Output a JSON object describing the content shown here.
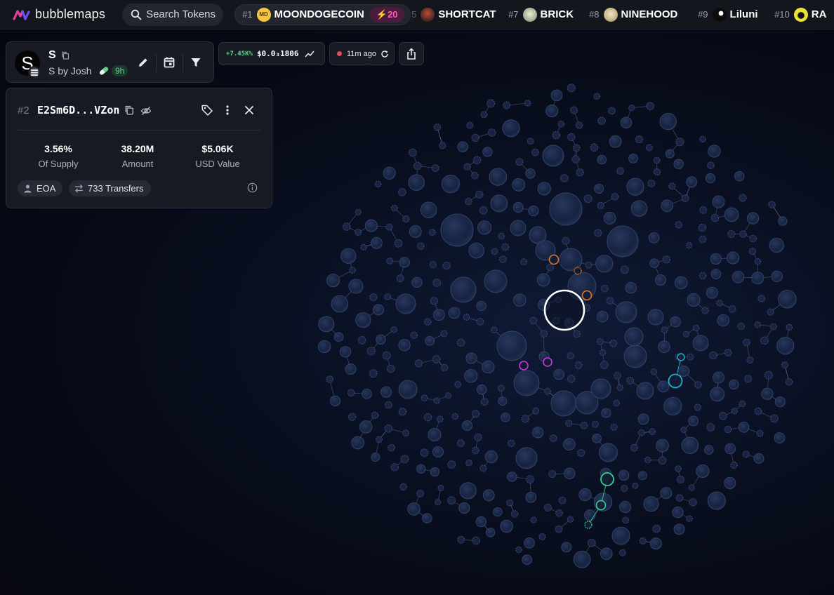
{
  "brand": {
    "name": "bubblemaps"
  },
  "search": {
    "label": "Search Tokens"
  },
  "trending": [
    {
      "rank": "#1",
      "name": "MOONDOGECOIN",
      "boost": "20",
      "avatar_text": "MD",
      "avatar_color": "#f3c745"
    },
    {
      "rank": "5",
      "name": "SHORTCAT",
      "avatar_color": "#5a2f2a"
    },
    {
      "rank": "#7",
      "name": "BRICK",
      "avatar_color": "#b9c2a8"
    },
    {
      "rank": "#8",
      "name": "NINEHOOD",
      "avatar_color": "#c8b48a"
    },
    {
      "rank": "#9",
      "name": "Liluni",
      "avatar_color": "#0c0c0c"
    },
    {
      "rank": "#10",
      "name": "RA",
      "avatar_color": "#e7e13a"
    }
  ],
  "token": {
    "symbol": "S",
    "avatar_letter": "S",
    "name": "S by Josh",
    "age": "9h"
  },
  "price": {
    "change": "+7.45K%",
    "value": "$0.0₃1806"
  },
  "refresh": {
    "label": "11m ago"
  },
  "wallet": {
    "rank": "#2",
    "address": "E2Sm6D...VZon",
    "stats": [
      {
        "value": "3.56%",
        "label": "Of Supply"
      },
      {
        "value": "38.20M",
        "label": "Amount"
      },
      {
        "value": "$5.06K",
        "label": "USD Value"
      }
    ],
    "type": "EOA",
    "transfers": "733 Transfers"
  },
  "colors": {
    "accent_green": "#5fd38f",
    "boost_pink": "#ff5fb4",
    "bubble_fill": "#1c2a4a",
    "highlight_orange": "#e0782a",
    "highlight_purple": "#c23be0",
    "highlight_cyan": "#1fb5c9",
    "highlight_green": "#2fd38a"
  }
}
